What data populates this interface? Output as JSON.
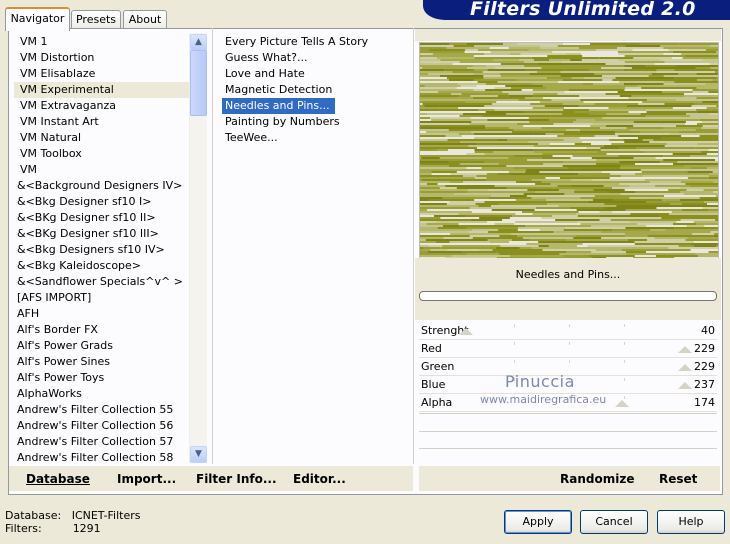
{
  "banner": {
    "title": "Filters Unlimited 2.0"
  },
  "tabs": [
    {
      "label": "Navigator"
    },
    {
      "label": "Presets"
    },
    {
      "label": "About"
    }
  ],
  "categories": [
    "VM 1",
    "VM Distortion",
    "VM Elisablaze",
    "VM Experimental",
    "VM Extravaganza",
    "VM Instant Art",
    "VM Natural",
    "VM Toolbox",
    "VM",
    "&<Background Designers IV>",
    "&<Bkg Designer sf10 I>",
    "&<BKg Designer sf10 II>",
    "&<BKg Designer sf10 III>",
    "&<Bkg Designers sf10 IV>",
    "&<Bkg Kaleidoscope>",
    "&<Sandflower Specials^v^ >",
    "[AFS IMPORT]",
    "AFH",
    "Alf's Border FX",
    "Alf's Power Grads",
    "Alf's Power Sines",
    "Alf's Power Toys",
    "AlphaWorks",
    "Andrew's Filter Collection 55",
    "Andrew's Filter Collection 56",
    "Andrew's Filter Collection 57",
    "Andrew's Filter Collection 58"
  ],
  "filters": [
    "Every Picture Tells A Story",
    "Guess  What?...",
    "Love and Hate",
    "Magnetic Detection",
    "Needles and Pins...",
    "Painting by Numbers",
    "TeeWee..."
  ],
  "selected_filter": "Needles and Pins...",
  "params": [
    {
      "label": "Strenght",
      "value": "40"
    },
    {
      "label": "Red",
      "value": "229"
    },
    {
      "label": "Green",
      "value": "229"
    },
    {
      "label": "Blue",
      "value": "237"
    },
    {
      "label": "Alpha",
      "value": "174"
    }
  ],
  "bottom_buttons": {
    "database": "Database",
    "import": "Import...",
    "filter_info": "Filter Info...",
    "editor": "Editor...",
    "randomize": "Randomize",
    "reset": "Reset"
  },
  "footer": {
    "database_label": "Database:",
    "database_value": "ICNET-Filters",
    "filters_label": "Filters:",
    "filters_value": "1291"
  },
  "dialog_buttons": {
    "apply": "Apply",
    "cancel": "Cancel",
    "help": "Help"
  },
  "watermark": {
    "name": "Pinuccia",
    "url": "www.maidiregrafica.eu"
  },
  "colors": {
    "banner": "#0a1e7e",
    "selection": "#316ac5",
    "preview_olive": "#8b8f1e",
    "preview_light": "#e2e3d0"
  }
}
